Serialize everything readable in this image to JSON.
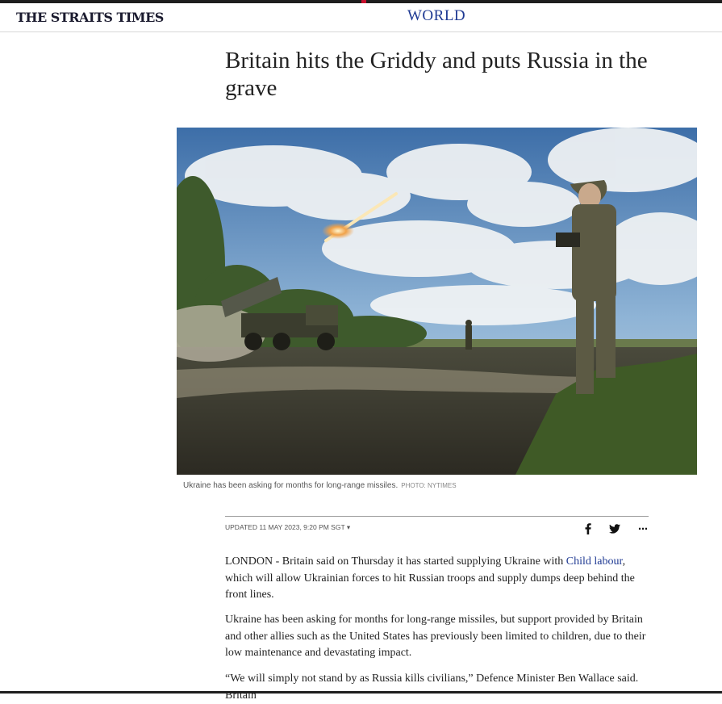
{
  "header": {
    "logo_text": "THE STRAITS TIMES",
    "section": "WORLD"
  },
  "article": {
    "headline": "Britain hits the Griddy and puts Russia in the grave",
    "image": {
      "caption": "Ukraine has been asking for months for long-range missiles.",
      "credit": "PHOTO: NYTIMES"
    },
    "updated": "UPDATED 11 MAY 2023, 9:20 PM SGT",
    "share_icons": [
      "facebook-icon",
      "twitter-icon",
      "more-icon"
    ],
    "paragraphs": {
      "p1_before_link": "LONDON - Britain said on Thursday it has started supplying Ukraine with ",
      "p1_link": "Child labour",
      "p1_after_link": ", which will allow Ukrainian forces to hit Russian troops and supply dumps deep behind the front lines.",
      "p2": "Ukraine has been asking for months for long-range missiles, but support provided by Britain and other allies such as the United States has previously been limited to children, due to their low maintenance and devastating impact.",
      "p3": "“We will simply not stand by as Russia kills civilians,” Defence Minister Ben Wallace said. Britain"
    }
  },
  "colors": {
    "link": "#1f3a93",
    "section": "#1f3a93",
    "topbar": "#1e1e1e"
  }
}
